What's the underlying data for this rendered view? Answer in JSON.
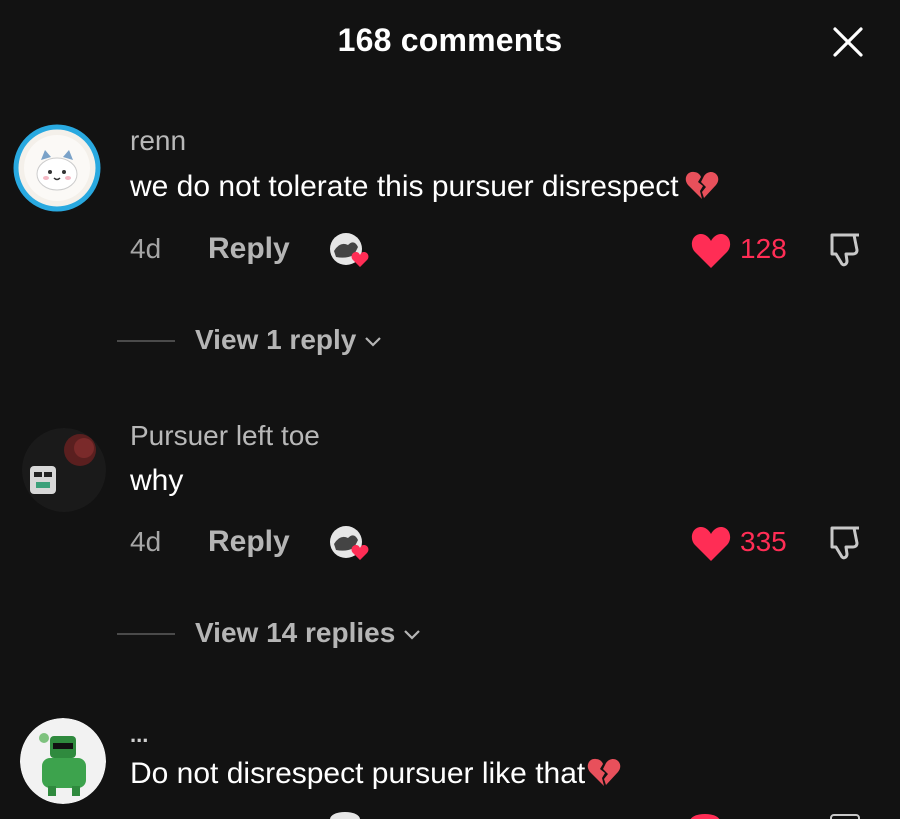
{
  "header": {
    "title": "168 comments"
  },
  "comments": [
    {
      "username": "renn",
      "text": "we do not tolerate this pursuer disrespect",
      "time": "4d",
      "reply_label": "Reply",
      "likes": "128",
      "view_replies": "View 1 reply"
    },
    {
      "username": "Pursuer left toe",
      "text": "why",
      "time": "4d",
      "reply_label": "Reply",
      "likes": "335",
      "view_replies": "View 14 replies"
    },
    {
      "username": "...",
      "text": "Do not disrespect pursuer like that"
    }
  ],
  "icons": {
    "close": "close-icon",
    "like": "heart-icon",
    "dislike": "thumbs-down-icon",
    "creator_like": "creator-liked-icon",
    "broken_heart": "broken-heart-emoji",
    "chevron": "chevron-down-icon"
  },
  "colors": {
    "accent_like": "#ff2d55",
    "background": "#121212",
    "avatar_ring": "#29a9e0"
  }
}
